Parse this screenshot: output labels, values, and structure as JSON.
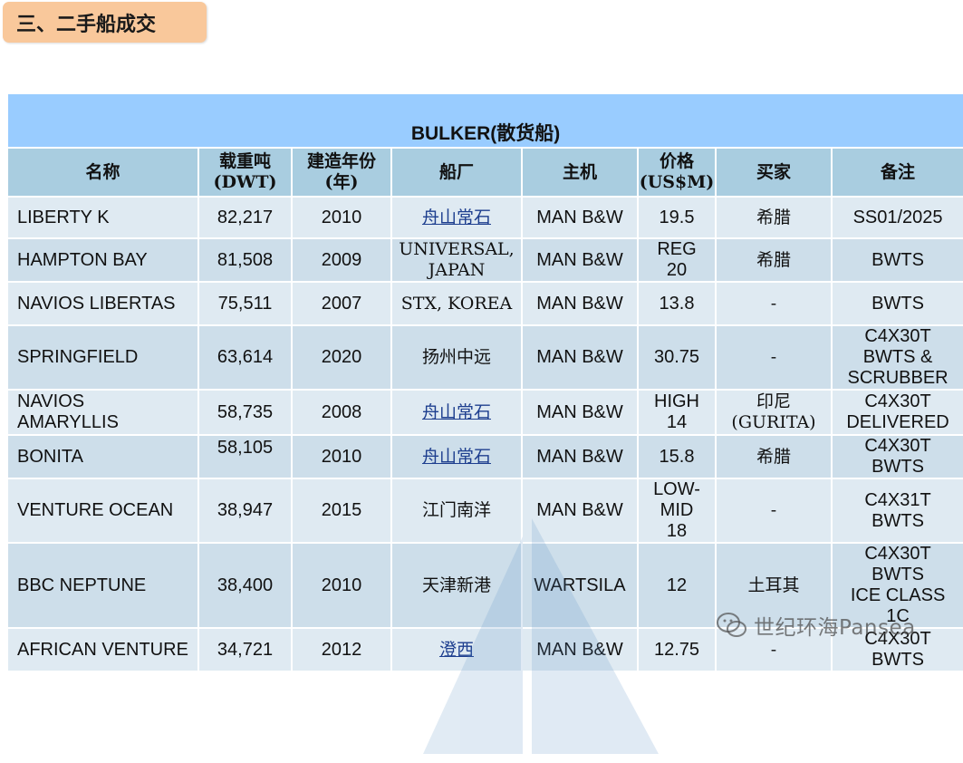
{
  "section_title": "三、二手船成交",
  "table": {
    "caption": "BULKER(散货船)",
    "headers": {
      "name": "名称",
      "dwt_1": "载重吨",
      "dwt_2": "(DWT)",
      "year_1": "建造年份",
      "year_2": "(年)",
      "yard": "船厂",
      "engine": "主机",
      "price_1": "价格",
      "price_2": "(US$M)",
      "buyer": "买家",
      "remarks": "备注"
    },
    "rows": [
      {
        "name": [
          "LIBERTY K"
        ],
        "dwt": "82,217",
        "year": "2010",
        "yard": [
          "舟山常石"
        ],
        "engine": "MAN B&W",
        "price": [
          "19.5"
        ],
        "buyer": [
          "希腊"
        ],
        "remarks": [
          "SS01/2025"
        ]
      },
      {
        "name": [
          "HAMPTON BAY"
        ],
        "dwt": "81,508",
        "year": "2009",
        "yard": [
          "UNIVERSAL,",
          "JAPAN"
        ],
        "engine": "MAN B&W",
        "price": [
          "REG",
          "20"
        ],
        "buyer": [
          "希腊"
        ],
        "remarks": [
          "BWTS"
        ]
      },
      {
        "name": [
          "NAVIOS LIBERTAS"
        ],
        "dwt": "75,511",
        "year": "2007",
        "yard": [
          "STX, KOREA"
        ],
        "engine": "MAN B&W",
        "price": [
          "13.8"
        ],
        "buyer": [
          "-"
        ],
        "remarks": [
          "BWTS"
        ]
      },
      {
        "name": [
          "SPRINGFIELD"
        ],
        "dwt": "63,614",
        "year": "2020",
        "yard": [
          "扬州中远"
        ],
        "engine": "MAN B&W",
        "price": [
          "30.75"
        ],
        "buyer": [
          "-"
        ],
        "remarks": [
          "C4X30T",
          "BWTS &",
          "SCRUBBER"
        ]
      },
      {
        "name": [
          "NAVIOS",
          "AMARYLLIS"
        ],
        "dwt": "58,735",
        "year": "2008",
        "yard": [
          "舟山常石"
        ],
        "engine": "MAN B&W",
        "price": [
          "HIGH",
          "14"
        ],
        "buyer": [
          "印尼",
          "(GURITA)"
        ],
        "remarks": [
          "C4X30T",
          "DELIVERED"
        ]
      },
      {
        "name": [
          "BONITA"
        ],
        "dwt": "58,105",
        "year": "2010",
        "yard": [
          "舟山常石"
        ],
        "engine": "MAN B&W",
        "price": [
          "15.8"
        ],
        "buyer": [
          "希腊"
        ],
        "remarks": [
          "C4X30T",
          "BWTS"
        ]
      },
      {
        "name": [
          "VENTURE OCEAN"
        ],
        "dwt": "38,947",
        "year": "2015",
        "yard": [
          "江门南洋"
        ],
        "engine": "MAN B&W",
        "price": [
          "LOW-",
          "MID",
          "18"
        ],
        "buyer": [
          "-"
        ],
        "remarks": [
          "C4X31T",
          "BWTS"
        ]
      },
      {
        "name": [
          "BBC NEPTUNE"
        ],
        "dwt": "38,400",
        "year": "2010",
        "yard": [
          "天津新港"
        ],
        "engine": "WARTSILA",
        "price": [
          "12"
        ],
        "buyer": [
          "土耳其"
        ],
        "remarks": [
          "C4X30T",
          "BWTS",
          "ICE CLASS",
          "1C"
        ]
      },
      {
        "name": [
          "AFRICAN VENTURE"
        ],
        "dwt": "34,721",
        "year": "2012",
        "yard": [
          "澄西"
        ],
        "engine": "MAN B&W",
        "price": [
          "12.75"
        ],
        "buyer": [
          "-"
        ],
        "remarks": [
          "C4X30T",
          "BWTS"
        ]
      }
    ]
  },
  "watermark_text": "世纪环海Pansea",
  "colors": {
    "title_bg": "#f9c89b",
    "caption_bg": "#99ccff",
    "header_bg": "#a9cde0",
    "row_light": "#dfeaf2",
    "row_dark": "#cddeea"
  }
}
